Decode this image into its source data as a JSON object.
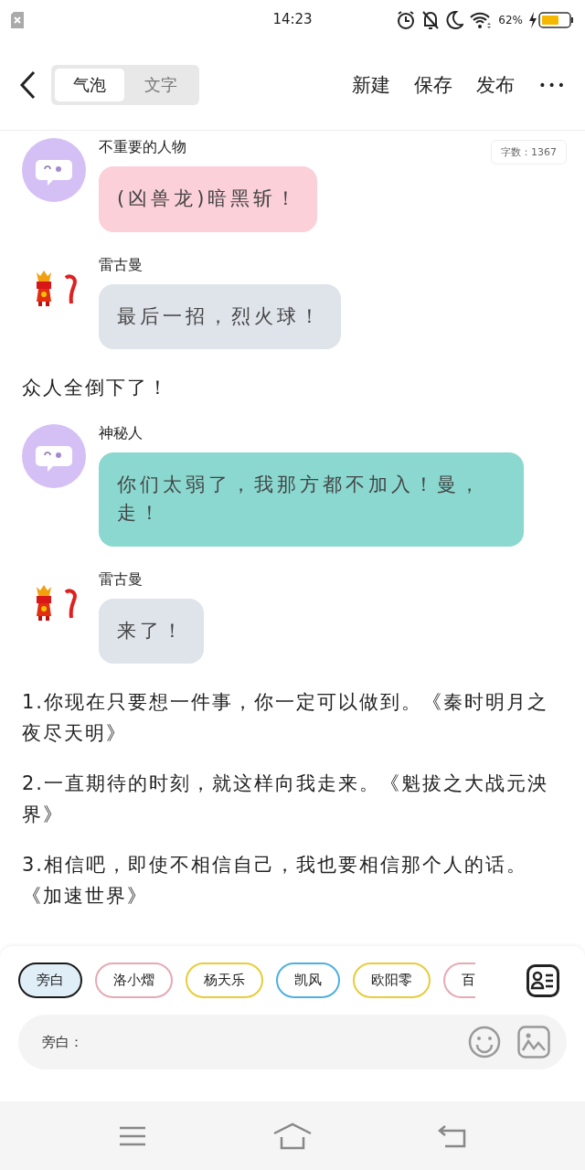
{
  "status_bar": {
    "time": "14:23",
    "battery": "62%"
  },
  "toolbar": {
    "tabs": [
      {
        "label": "气泡",
        "selected": true
      },
      {
        "label": "文字",
        "selected": false
      }
    ],
    "actions": [
      "新建",
      "保存",
      "发布"
    ],
    "more": "•••"
  },
  "word_count": "字数：1367",
  "messages": [
    {
      "kind": "bubble",
      "avatar": {
        "kind": "chat"
      },
      "name": "不重要的人物",
      "text": "(凶兽龙)暗黑斩！",
      "color": "#fbd0d9"
    },
    {
      "kind": "bubble",
      "avatar": {
        "kind": "figure"
      },
      "name": "雷古曼",
      "text": "最后一招，烈火球！",
      "color": "#dfe3ea"
    },
    {
      "kind": "narration",
      "text": "众人全倒下了！"
    },
    {
      "kind": "bubble",
      "avatar": {
        "kind": "chat"
      },
      "name": "神秘人",
      "text": "你们太弱了，我那方都不加入！曼，走！",
      "color": "#8ad8d0"
    },
    {
      "kind": "bubble",
      "avatar": {
        "kind": "figure"
      },
      "name": "雷古曼",
      "text": "来了！",
      "color": "#dfe3ea"
    },
    {
      "kind": "narration",
      "text": "1.你现在只要想一件事，你一定可以做到。《秦时明月之夜尽天明》"
    },
    {
      "kind": "narration",
      "text": "2.一直期待的时刻，就这样向我走来。《魁拔之大战元泱界》"
    },
    {
      "kind": "narration",
      "text": "3.相信吧，即使不相信自己，我也要相信那个人的话。《加速世界》"
    }
  ],
  "composer": {
    "roles": [
      {
        "label": "旁白",
        "selected": true,
        "color": "#1a1a1a"
      },
      {
        "label": "洛小熠",
        "selected": false,
        "color": "#e6a9b4"
      },
      {
        "label": "杨天乐",
        "selected": false,
        "color": "#e8cc3a"
      },
      {
        "label": "凯风",
        "selected": false,
        "color": "#4fb0e0"
      },
      {
        "label": "欧阳零",
        "selected": false,
        "color": "#e8cc3a"
      },
      {
        "label": "百",
        "selected": false,
        "color": "#e6a9b4"
      }
    ],
    "placeholder": "旁白："
  }
}
